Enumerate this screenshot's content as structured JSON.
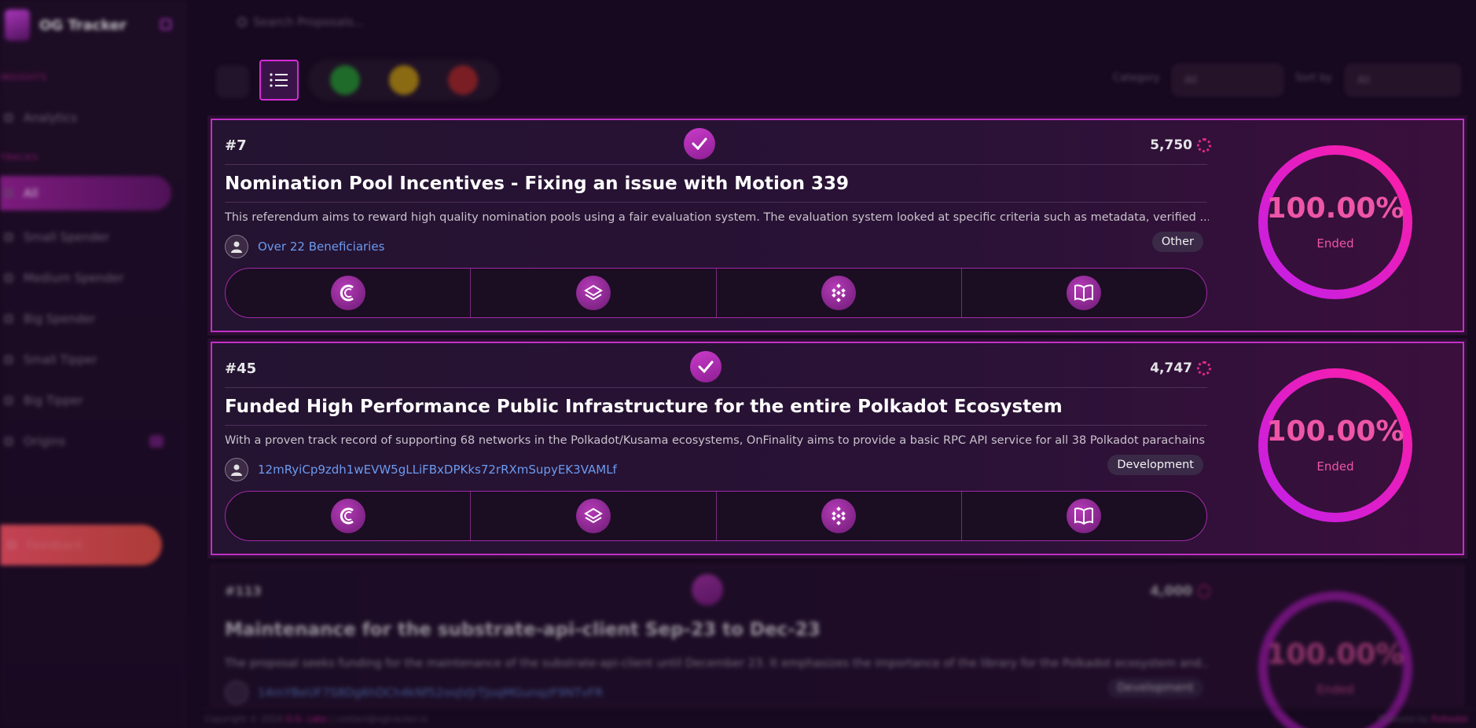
{
  "app": {
    "title": "OG Tracker"
  },
  "search": {
    "placeholder": "Search Proposals..."
  },
  "sidebar": {
    "section_insights": "INSIGHTS",
    "analytics_label": "Analytics",
    "section_tracks": "TRACKS",
    "items": [
      {
        "label": "All"
      },
      {
        "label": "Small Spender"
      },
      {
        "label": "Medium Spender"
      },
      {
        "label": "Big Spender"
      },
      {
        "label": "Small Tipper"
      },
      {
        "label": "Big Tipper"
      },
      {
        "label": "Origins"
      }
    ],
    "feedback_label": "Feedback"
  },
  "toolbar": {
    "category_label": "Category",
    "category_value": "All",
    "sortby_label": "Sort by",
    "sortby_value": "All",
    "status_colors": [
      "#1f6b2a",
      "#8a6a12",
      "#7a1e24"
    ]
  },
  "proposals": [
    {
      "number": "#7",
      "amount": "5,750",
      "title": "Nomination Pool Incentives - Fixing an issue with Motion 339",
      "description": "This referendum aims to reward high quality nomination pools using a fair evaluation system. The evaluation system looked at specific criteria such as metadata, verified ...",
      "beneficiary": "Over 22 Beneficiaries",
      "category": "Other",
      "percent": "100.00%",
      "status": "Ended",
      "progress": 1.0
    },
    {
      "number": "#45",
      "amount": "4,747",
      "title": "Funded High Performance Public Infrastructure for the entire Polkadot Ecosystem",
      "description": "With a proven track record of supporting 68 networks in the Polkadot/Kusama ecosystems, OnFinality aims to provide a basic RPC API service for all 38 Polkadot parachains",
      "beneficiary": "12mRyiCp9zdh1wEVW5gLLiFBxDPKks72rRXmSupyEK3VAMLf",
      "category": "Development",
      "percent": "100.00%",
      "status": "Ended",
      "progress": 1.0
    },
    {
      "number": "#113",
      "amount": "4,000",
      "title": "Maintenance for the substrate-api-client Sep-23 to Dec-23",
      "description": "The proposal seeks funding for the maintenance of the substrate-api-client until December 23. It emphasizes the importance of the library for the Polkadot ecosystem and...",
      "beneficiary": "14mYBeUF7S8Dg6hDCh4kNf52ooJVJrTJoqMGunqzF9NTvFR",
      "category": "Development",
      "percent": "100.00%",
      "status": "Ended",
      "progress": 1.0
    }
  ],
  "footer": {
    "copyright": "Copyright © 2024",
    "brand": "O.G. Labs",
    "contact": "contact@ogtracker.io",
    "powered": "Powered by",
    "powered_brand": "Polkadot"
  },
  "accent_colors": {
    "primary": "#d52bd6",
    "pink": "#ee55a8",
    "link": "#6b9bf0"
  }
}
